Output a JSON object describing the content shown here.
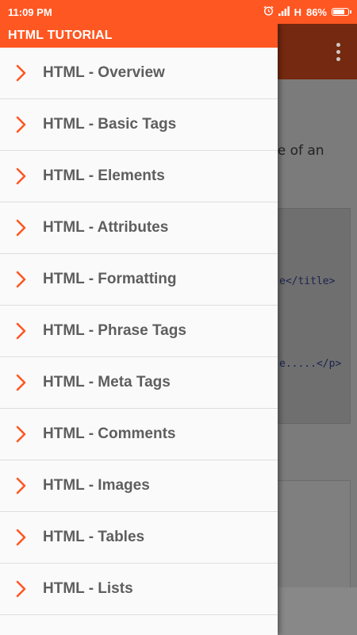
{
  "status_bar": {
    "time": "11:09 PM",
    "network": "H",
    "battery": "86%",
    "battery_level": 0.86
  },
  "drawer": {
    "title": "HTML TUTORIAL",
    "items": [
      {
        "label": "HTML - Overview",
        "icon": "chevron-right-icon"
      },
      {
        "label": "HTML - Basic Tags",
        "icon": "chevron-right-icon"
      },
      {
        "label": "HTML - Elements",
        "icon": "chevron-right-icon"
      },
      {
        "label": "HTML - Attributes",
        "icon": "chevron-right-icon"
      },
      {
        "label": "HTML - Formatting",
        "icon": "chevron-right-icon"
      },
      {
        "label": "HTML - Phrase Tags",
        "icon": "chevron-right-icon"
      },
      {
        "label": "HTML - Meta Tags",
        "icon": "chevron-right-icon"
      },
      {
        "label": "HTML - Comments",
        "icon": "chevron-right-icon"
      },
      {
        "label": "HTML - Images",
        "icon": "chevron-right-icon"
      },
      {
        "label": "HTML - Tables",
        "icon": "chevron-right-icon"
      },
      {
        "label": "HTML - Lists",
        "icon": "chevron-right-icon"
      }
    ]
  },
  "background": {
    "partial_text": "le of an",
    "code_lines": [
      "e</title>",
      "e.....</p>"
    ]
  },
  "colors": {
    "accent": "#ff5722",
    "chevron": "#ff5722",
    "item_text": "#5e5e5e",
    "dimmed_toolbar": "#752910"
  }
}
